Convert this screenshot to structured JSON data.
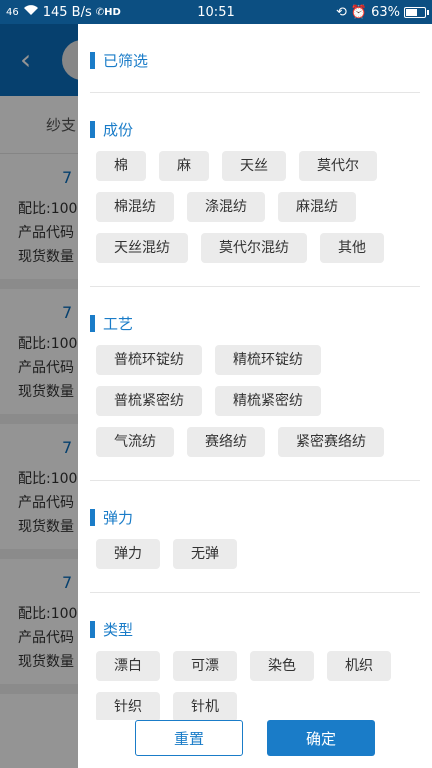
{
  "status_bar": {
    "signal": "46",
    "speed": "145 B/s",
    "hd": "HD",
    "time": "10:51",
    "battery": "63%",
    "battery_level": 0.63
  },
  "background": {
    "filter_label": "纱支",
    "cards": [
      {
        "num": "7",
        "lines": [
          "配比:100",
          "产品代码",
          "现货数量"
        ]
      },
      {
        "num": "7",
        "lines": [
          "配比:100",
          "产品代码",
          "现货数量"
        ]
      },
      {
        "num": "7",
        "lines": [
          "配比:100",
          "产品代码",
          "现货数量"
        ]
      },
      {
        "num": "7",
        "lines": [
          "配比:100",
          "产品代码",
          "现货数量"
        ]
      }
    ]
  },
  "drawer": {
    "selected_title": "已筛选",
    "sections": [
      {
        "title": "成份",
        "options": [
          "棉",
          "麻",
          "天丝",
          "莫代尔",
          "棉混纺",
          "涤混纺",
          "麻混纺",
          "天丝混纺",
          "莫代尔混纺",
          "其他"
        ]
      },
      {
        "title": "工艺",
        "options": [
          "普梳环锭纺",
          "精梳环锭纺",
          "普梳紧密纺",
          "精梳紧密纺",
          "气流纺",
          "赛络纺",
          "紧密赛络纺"
        ]
      },
      {
        "title": "弹力",
        "options": [
          "弹力",
          "无弹"
        ]
      },
      {
        "title": "类型",
        "options": [
          "漂白",
          "可漂",
          "染色",
          "机织",
          "针织",
          "针机"
        ]
      }
    ],
    "reset_label": "重置",
    "confirm_label": "确定"
  }
}
